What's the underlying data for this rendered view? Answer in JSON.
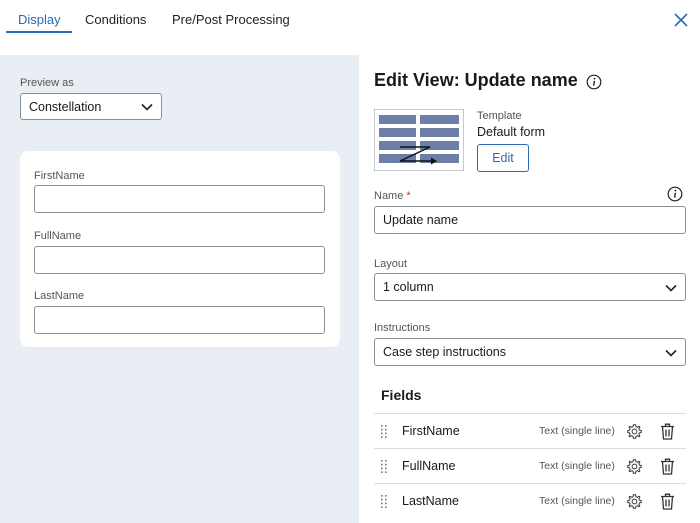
{
  "tabs": [
    {
      "label": "Display",
      "active": true
    },
    {
      "label": "Conditions",
      "active": false
    },
    {
      "label": "Pre/Post Processing",
      "active": false
    }
  ],
  "preview": {
    "label": "Preview as",
    "selected": "Constellation",
    "fields": [
      {
        "label": "FirstName",
        "value": ""
      },
      {
        "label": "FullName",
        "value": ""
      },
      {
        "label": "LastName",
        "value": ""
      }
    ]
  },
  "editor": {
    "title": "Edit View: Update name",
    "template": {
      "label": "Template",
      "value": "Default form",
      "edit_label": "Edit"
    },
    "name": {
      "label": "Name",
      "required_mark": "*",
      "value": "Update name"
    },
    "layout": {
      "label": "Layout",
      "value": "1 column"
    },
    "instructions": {
      "label": "Instructions",
      "value": "Case step instructions"
    },
    "fields_heading": "Fields",
    "fields": [
      {
        "name": "FirstName",
        "type": "Text (single line)"
      },
      {
        "name": "FullName",
        "type": "Text (single line)"
      },
      {
        "name": "LastName",
        "type": "Text (single line)"
      }
    ]
  },
  "colors": {
    "accent": "#2a6ab8",
    "panel_bg": "#e9eef4",
    "required": "#c0392b"
  },
  "icons": [
    "close-icon",
    "chevron-down-icon",
    "info-icon",
    "template-thumbnail-icon",
    "drag-handle-icon",
    "gear-icon",
    "trash-icon"
  ]
}
